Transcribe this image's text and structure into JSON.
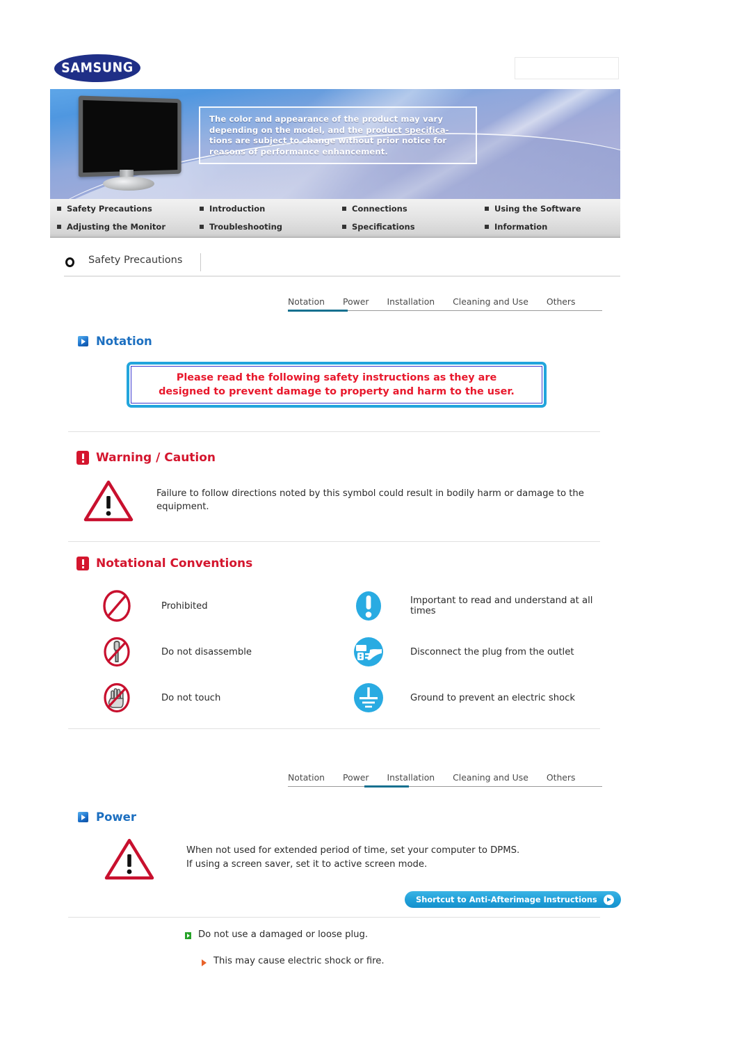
{
  "brand": {
    "logo_text": "SAMSUNG"
  },
  "banner": {
    "callout_lines": [
      "The color and appearance of the product may vary",
      "depending on the model, and the product specifica-",
      "tions are subject to change without prior notice for",
      "reasons of performance enhancement."
    ]
  },
  "nav": {
    "items": [
      "Safety Precautions",
      "Introduction",
      "Connections",
      "Using the Software",
      "Adjusting the Monitor",
      "Troubleshooting",
      "Specifications",
      "Information"
    ]
  },
  "breadcrumb": {
    "label": "Safety Precautions"
  },
  "tabs": {
    "items": [
      "Notation",
      "Power",
      "Installation",
      "Cleaning and Use",
      "Others"
    ],
    "active_top": "Notation",
    "active_bottom": "Power",
    "active_color": "#15708f"
  },
  "notation_section": {
    "heading": "Notation",
    "notice_lines": [
      "Please read the following safety instructions as they are",
      "designed to prevent damage to property and harm to the user."
    ],
    "notice_text_color": "#e8182c",
    "notice_border_outer": "#22a5dc",
    "notice_border_inner": "#3a3ad0"
  },
  "warning_section": {
    "heading": "Warning / Caution",
    "heading_color": "#d4162e",
    "body": "Failure to follow directions noted by this symbol could result in bodily harm or damage to the equipment."
  },
  "conventions_section": {
    "heading": "Notational Conventions",
    "rows": [
      {
        "left_label": "Prohibited",
        "right_label": "Important to read and understand at all times"
      },
      {
        "left_label": "Do not disassemble",
        "right_label": "Disconnect the plug from the outlet"
      },
      {
        "left_label": "Do not touch",
        "right_label": "Ground to prevent an electric shock"
      }
    ]
  },
  "power_section": {
    "heading": "Power",
    "body_lines": [
      "When not used for extended period of time, set your computer to DPMS.",
      "If using a screen saver, set it to active screen mode."
    ],
    "shortcut_label": "Shortcut to Anti-Afterimage Instructions",
    "bullet": "Do not use a damaged or loose plug.",
    "sub_bullet": "This may cause electric shock or fire."
  }
}
